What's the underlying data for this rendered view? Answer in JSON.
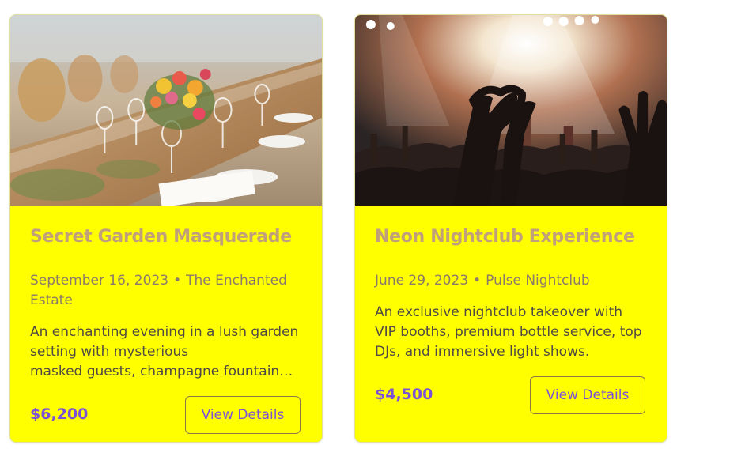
{
  "events": [
    {
      "title": "Secret Garden Masquerade",
      "date": "September 16, 2023",
      "separator": "•",
      "venue": "The Enchanted Estate",
      "description_main": "An enchanting evening in a lush garden setting with mysterious",
      "description_clip": "masked guests, champagne fountain…",
      "price": "$6,200",
      "button_label": "View Details",
      "image_icon": "banquet-table-photo"
    },
    {
      "title": "Neon Nightclub Experience",
      "date": "June 29, 2023",
      "separator": "•",
      "venue": "Pulse Nightclub",
      "description": "An exclusive nightclub takeover with VIP booths, premium bottle service, top DJs, and immersive light shows.",
      "price": "$4,500",
      "button_label": "View Details",
      "image_icon": "concert-crowd-photo"
    }
  ],
  "colors": {
    "card_background": "#ffff00",
    "title": "#c0a07a",
    "price": "#7b52d6",
    "button_text": "#7b52d6"
  }
}
